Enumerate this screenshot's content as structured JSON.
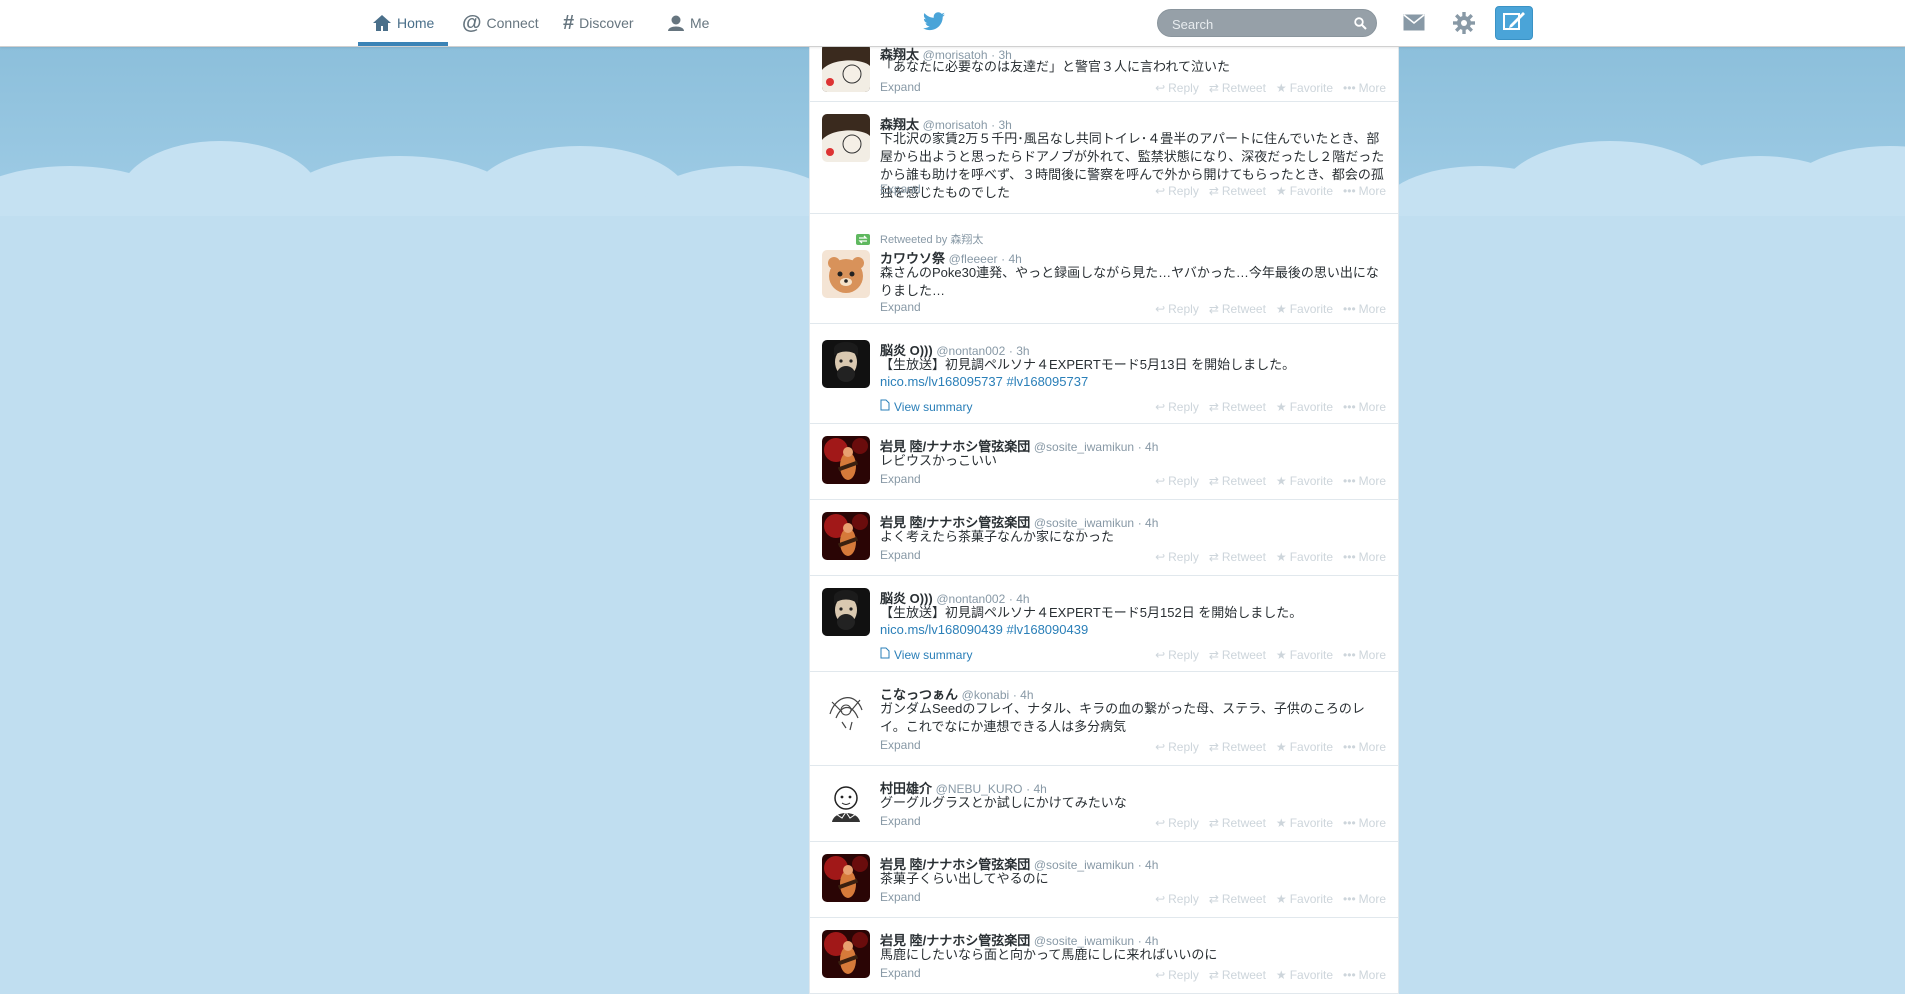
{
  "nav": {
    "home": "Home",
    "connect": "Connect",
    "discover": "Discover",
    "me": "Me"
  },
  "search": {
    "placeholder": "Search"
  },
  "colors": {
    "accent": "#3b83b6",
    "link": "#2a7fb8",
    "compose": "#4aa4d8",
    "retweet_green": "#5fb85f"
  },
  "icons": [
    "home-icon",
    "connect-icon",
    "discover-icon",
    "me-icon",
    "twitter-bird-icon",
    "search-icon",
    "mail-icon",
    "gear-icon",
    "compose-icon"
  ],
  "actions": {
    "reply": "Reply",
    "retweet": "Retweet",
    "favorite": "Favorite",
    "more": "More"
  },
  "tweets": [
    {
      "fullname": "森翔太",
      "username": "@morisatoh",
      "time": "· 3h",
      "text": "「あなたに必要なのは友達だ」と警官３人に言われて泣いた",
      "expand": "Expand"
    },
    {
      "fullname": "森翔太",
      "username": "@morisatoh",
      "time": "· 3h",
      "text": "下北沢の家賃2万５千円･風呂なし共同トイレ･４畳半のアパートに住んでいたとき、部屋から出ようと思ったらドアノブが外れて、監禁状態になり、深夜だったし２階だったから誰も助けを呼べず、３時間後に警察を呼んで外から開けてもらったとき、都会の孤独を感じたものでした",
      "expand": "Expand"
    },
    {
      "retweeted_by": "Retweeted by 森翔太",
      "fullname": "カワウソ祭",
      "username": "@fleeeer",
      "time": "· 4h",
      "text": "森さんのPoke30連発、やっと録画しながら見た…ヤバかった…今年最後の思い出になりました…",
      "expand": "Expand"
    },
    {
      "fullname": "脳炎 O)))",
      "username": "@nontan002",
      "time": "· 3h",
      "text": "【生放送】初見調ペルソナ４EXPERTモード5月13日 を開始しました。",
      "link": "nico.ms/lv168095737",
      "hashtag": "#lv168095737",
      "summary": "View summary"
    },
    {
      "fullname": "岩見 陸/ナナホシ管弦楽団",
      "username": "@sosite_iwamikun",
      "time": "· 4h",
      "text": "レビウスかっこいい",
      "expand": "Expand"
    },
    {
      "fullname": "岩見 陸/ナナホシ管弦楽団",
      "username": "@sosite_iwamikun",
      "time": "· 4h",
      "text": "よく考えたら茶菓子なんか家になかった",
      "expand": "Expand"
    },
    {
      "fullname": "脳炎 O)))",
      "username": "@nontan002",
      "time": "· 4h",
      "text": "【生放送】初見調ペルソナ４EXPERTモード5月152日 を開始しました。",
      "link": "nico.ms/lv168090439",
      "hashtag": "#lv168090439",
      "summary": "View summary"
    },
    {
      "fullname": "こなっつぁん",
      "username": "@konabi",
      "time": "· 4h",
      "text": "ガンダムSeedのフレイ、ナタル、キラの血の繋がった母、ステラ、子供のころのレイ。これでなにか連想できる人は多分病気",
      "expand": "Expand"
    },
    {
      "fullname": "村田雄介",
      "username": "@NEBU_KURO",
      "time": "· 4h",
      "text": "グーグルグラスとか試しにかけてみたいな",
      "expand": "Expand"
    },
    {
      "fullname": "岩見 陸/ナナホシ管弦楽団",
      "username": "@sosite_iwamikun",
      "time": "· 4h",
      "text": "茶菓子くらい出してやるのに",
      "expand": "Expand"
    },
    {
      "fullname": "岩見 陸/ナナホシ管弦楽団",
      "username": "@sosite_iwamikun",
      "time": "· 4h",
      "text": "馬鹿にしたいなら面と向かって馬鹿にしに来ればいいのに",
      "expand": "Expand"
    }
  ]
}
